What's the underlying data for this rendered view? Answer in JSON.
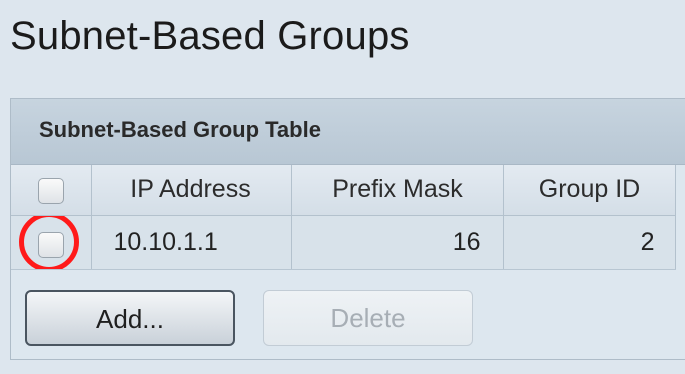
{
  "page": {
    "title": "Subnet-Based Groups"
  },
  "table": {
    "caption": "Subnet-Based Group Table",
    "columns": [
      "IP Address",
      "Prefix Mask",
      "Group ID"
    ],
    "rows": [
      {
        "ip_address": "10.10.1.1",
        "prefix_mask": "16",
        "group_id": "2",
        "selected": false,
        "highlighted": true
      }
    ]
  },
  "actions": {
    "add_label": "Add...",
    "delete_label": "Delete",
    "delete_enabled": false
  },
  "colors": {
    "highlight_ring": "#ff1a1a",
    "background": "#dde6ee"
  }
}
